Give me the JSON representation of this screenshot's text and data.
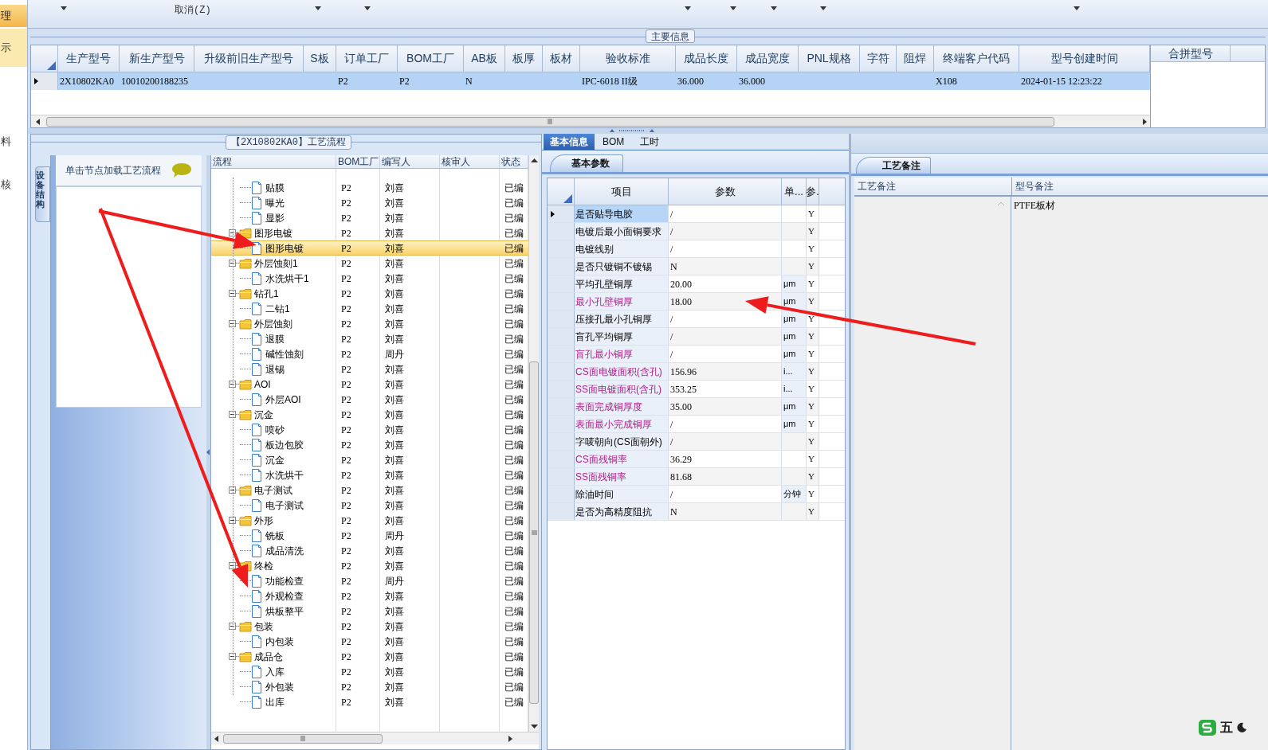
{
  "sidebar": {
    "items": [
      {
        "label": "理",
        "selected": true,
        "highlighted": true
      },
      {
        "label": "示",
        "selected": false,
        "highlighted": true
      },
      {
        "label": "料",
        "selected": false,
        "highlighted": false
      },
      {
        "label": "核",
        "selected": false,
        "highlighted": false
      }
    ]
  },
  "toolbar": {
    "cancel_button": "取消(Z)"
  },
  "main_info": {
    "title": "主要信息",
    "columns": [
      "生产型号",
      "新生产型号",
      "升级前旧生产型号",
      "S板",
      "订单工厂",
      "BOM工厂",
      "AB板",
      "板厚",
      "板材",
      "验收标准",
      "成品长度",
      "成品宽度",
      "PNL规格",
      "字符",
      "阻焊",
      "终端客户代码",
      "型号创建时间"
    ],
    "rows": [
      {
        "selected": true,
        "cells": [
          "2X10802KA0",
          "10010200188235",
          null,
          null,
          "P2",
          "P2",
          "N",
          null,
          null,
          "IPC-6018 II级",
          "36.000",
          "36.000",
          null,
          null,
          null,
          "X108",
          "2024-01-15 12:23:22"
        ]
      }
    ],
    "side_columns": [
      "合拼型号"
    ]
  },
  "process": {
    "title": "【2X10802KA0】工艺流程",
    "side_tab": "设备结构",
    "hint": "单击节点加载工艺流程",
    "columns": [
      "流程",
      "BOM工厂",
      "编写人",
      "核审人",
      "状态"
    ],
    "nodes": [
      {
        "kind": "leaf",
        "label": "贴膜",
        "bom": "P2",
        "writer": "刘喜",
        "status": "已编",
        "selected": false
      },
      {
        "kind": "leaf",
        "label": "曝光",
        "bom": "P2",
        "writer": "刘喜",
        "status": "已编",
        "selected": false
      },
      {
        "kind": "leaf",
        "label": "显影",
        "bom": "P2",
        "writer": "刘喜",
        "status": "已编",
        "selected": false
      },
      {
        "kind": "folder",
        "label": "图形电镀",
        "bom": "P2",
        "writer": "刘喜",
        "status": "已编",
        "selected": false,
        "expanded": true,
        "children": [
          {
            "kind": "leaf",
            "label": "图形电镀",
            "bom": "P2",
            "writer": "刘喜",
            "status": "已编",
            "selected": true
          }
        ]
      },
      {
        "kind": "folder",
        "label": "外层蚀刻1",
        "bom": "P2",
        "writer": "刘喜",
        "status": "已编",
        "selected": false,
        "expanded": true,
        "children": [
          {
            "kind": "leaf",
            "label": "水洗烘干1",
            "bom": "P2",
            "writer": "刘喜",
            "status": "已编",
            "selected": false
          }
        ]
      },
      {
        "kind": "folder",
        "label": "钻孔1",
        "bom": "P2",
        "writer": "刘喜",
        "status": "已编",
        "selected": false,
        "expanded": true,
        "children": [
          {
            "kind": "leaf",
            "label": "二钻1",
            "bom": "P2",
            "writer": "刘喜",
            "status": "已编",
            "selected": false
          }
        ]
      },
      {
        "kind": "folder",
        "label": "外层蚀刻",
        "bom": "P2",
        "writer": "刘喜",
        "status": "已编",
        "selected": false,
        "expanded": true,
        "children": [
          {
            "kind": "leaf",
            "label": "退膜",
            "bom": "P2",
            "writer": "刘喜",
            "status": "已编",
            "selected": false
          },
          {
            "kind": "leaf",
            "label": "碱性蚀刻",
            "bom": "P2",
            "writer": "周丹",
            "status": "已编",
            "selected": false
          },
          {
            "kind": "leaf",
            "label": "退锡",
            "bom": "P2",
            "writer": "刘喜",
            "status": "已编",
            "selected": false
          }
        ]
      },
      {
        "kind": "folder",
        "label": "AOI",
        "bom": "P2",
        "writer": "刘喜",
        "status": "已编",
        "selected": false,
        "expanded": true,
        "children": [
          {
            "kind": "leaf",
            "label": "外层AOI",
            "bom": "P2",
            "writer": "刘喜",
            "status": "已编",
            "selected": false
          }
        ]
      },
      {
        "kind": "folder",
        "label": "沉金",
        "bom": "P2",
        "writer": "刘喜",
        "status": "已编",
        "selected": false,
        "expanded": true,
        "children": [
          {
            "kind": "leaf",
            "label": "喷砂",
            "bom": "P2",
            "writer": "刘喜",
            "status": "已编",
            "selected": false
          },
          {
            "kind": "leaf",
            "label": "板边包胶",
            "bom": "P2",
            "writer": "刘喜",
            "status": "已编",
            "selected": false
          },
          {
            "kind": "leaf",
            "label": "沉金",
            "bom": "P2",
            "writer": "刘喜",
            "status": "已编",
            "selected": false
          },
          {
            "kind": "leaf",
            "label": "水洗烘干",
            "bom": "P2",
            "writer": "刘喜",
            "status": "已编",
            "selected": false
          }
        ]
      },
      {
        "kind": "folder",
        "label": "电子测试",
        "bom": "P2",
        "writer": "刘喜",
        "status": "已编",
        "selected": false,
        "expanded": true,
        "children": [
          {
            "kind": "leaf",
            "label": "电子测试",
            "bom": "P2",
            "writer": "刘喜",
            "status": "已编",
            "selected": false
          }
        ]
      },
      {
        "kind": "folder",
        "label": "外形",
        "bom": "P2",
        "writer": "刘喜",
        "status": "已编",
        "selected": false,
        "expanded": true,
        "children": [
          {
            "kind": "leaf",
            "label": "铣板",
            "bom": "P2",
            "writer": "周丹",
            "status": "已编",
            "selected": false
          },
          {
            "kind": "leaf",
            "label": "成品清洗",
            "bom": "P2",
            "writer": "刘喜",
            "status": "已编",
            "selected": false
          }
        ]
      },
      {
        "kind": "folder",
        "label": "终检",
        "bom": "P2",
        "writer": "刘喜",
        "status": "已编",
        "selected": false,
        "expanded": true,
        "children": [
          {
            "kind": "leaf",
            "label": "功能检查",
            "bom": "P2",
            "writer": "周丹",
            "status": "已编",
            "selected": false
          },
          {
            "kind": "leaf",
            "label": "外观检查",
            "bom": "P2",
            "writer": "刘喜",
            "status": "已编",
            "selected": false
          },
          {
            "kind": "leaf",
            "label": "烘板整平",
            "bom": "P2",
            "writer": "刘喜",
            "status": "已编",
            "selected": false
          }
        ]
      },
      {
        "kind": "folder",
        "label": "包装",
        "bom": "P2",
        "writer": "刘喜",
        "status": "已编",
        "selected": false,
        "expanded": true,
        "children": [
          {
            "kind": "leaf",
            "label": "内包装",
            "bom": "P2",
            "writer": "刘喜",
            "status": "已编",
            "selected": false
          }
        ]
      },
      {
        "kind": "folder",
        "label": "成品仓",
        "bom": "P2",
        "writer": "刘喜",
        "status": "已编",
        "selected": false,
        "expanded": true,
        "children": [
          {
            "kind": "leaf",
            "label": "入库",
            "bom": "P2",
            "writer": "刘喜",
            "status": "已编",
            "selected": false
          },
          {
            "kind": "leaf",
            "label": "外包装",
            "bom": "P2",
            "writer": "刘喜",
            "status": "已编",
            "selected": false
          },
          {
            "kind": "leaf",
            "label": "出库",
            "bom": "P2",
            "writer": "刘喜",
            "status": "已编",
            "selected": false
          }
        ]
      }
    ]
  },
  "detail": {
    "tabs": [
      {
        "label": "基本信息",
        "selected": true
      },
      {
        "label": "BOM",
        "selected": false
      },
      {
        "label": "工时",
        "selected": false
      }
    ],
    "subtab": "基本参数",
    "columns": [
      "项目",
      "参数",
      "单...",
      "参."
    ],
    "rows": [
      {
        "item": "是否贴导电胶",
        "value": "/",
        "flag": "Y",
        "emphasized": false,
        "selected": true
      },
      {
        "item": "电镀后最小面铜要求",
        "value": "/",
        "flag": "Y",
        "emphasized": false,
        "selected": false
      },
      {
        "item": "电镀线别",
        "value": "/",
        "flag": "Y",
        "emphasized": false,
        "selected": false
      },
      {
        "item": "是否只镀铜不镀锡",
        "value": "N",
        "flag": "Y",
        "emphasized": false,
        "selected": false
      },
      {
        "item": "平均孔壁铜厚",
        "value": "20.00",
        "unit": "μm",
        "flag": "Y",
        "emphasized": false,
        "selected": false
      },
      {
        "item": "最小孔壁铜厚",
        "value": "18.00",
        "unit": "μm",
        "flag": "Y",
        "emphasized": true,
        "selected": false
      },
      {
        "item": "压接孔最小孔铜厚",
        "value": "/",
        "unit": "μm",
        "flag": "Y",
        "emphasized": false,
        "selected": false
      },
      {
        "item": "盲孔平均铜厚",
        "value": "/",
        "unit": "μm",
        "flag": "Y",
        "emphasized": false,
        "selected": false
      },
      {
        "item": "盲孔最小铜厚",
        "value": "/",
        "unit": "μm",
        "flag": "Y",
        "emphasized": true,
        "selected": false
      },
      {
        "item": "CS面电镀面积(含孔)",
        "value": "156.96",
        "unit": "i...",
        "flag": "Y",
        "emphasized": true,
        "selected": false
      },
      {
        "item": "SS面电镀面积(含孔)",
        "value": "353.25",
        "unit": "i...",
        "flag": "Y",
        "emphasized": true,
        "selected": false
      },
      {
        "item": "表面完成铜厚度",
        "value": "35.00",
        "unit": "μm",
        "flag": "Y",
        "emphasized": true,
        "selected": false
      },
      {
        "item": "表面最小完成铜厚",
        "value": "/",
        "unit": "μm",
        "flag": "Y",
        "emphasized": true,
        "selected": false
      },
      {
        "item": "字唛朝向(CS面朝外)",
        "value": "/",
        "flag": "Y",
        "emphasized": false,
        "selected": false
      },
      {
        "item": "CS面残铜率",
        "value": "36.29",
        "flag": "Y",
        "emphasized": true,
        "selected": false
      },
      {
        "item": "SS面残铜率",
        "value": "81.68",
        "flag": "Y",
        "emphasized": true,
        "selected": false
      },
      {
        "item": "除油时间",
        "value": "/",
        "unit": "分钟",
        "flag": "Y",
        "emphasized": false,
        "selected": false
      },
      {
        "item": "是否为高精度阻抗",
        "value": "N",
        "flag": "Y",
        "emphasized": false,
        "selected": false
      }
    ]
  },
  "remarks": {
    "tab": "工艺备注",
    "columns": [
      "工艺备注",
      "型号备注"
    ],
    "model_note": "PTFE板材"
  },
  "ime": {
    "label": "五"
  }
}
